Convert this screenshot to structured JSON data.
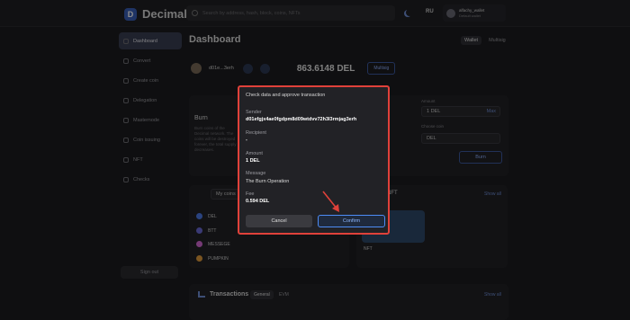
{
  "app": {
    "name": "Decimal"
  },
  "search": {
    "placeholder": "Search by address, hash, block, coins, NFTs"
  },
  "header": {
    "lang": "RU",
    "account_name": "alfachy_wallet",
    "account_sub": "Default wallet"
  },
  "sidebar": {
    "items": [
      {
        "label": "Dashboard"
      },
      {
        "label": "Convert"
      },
      {
        "label": "Create coin"
      },
      {
        "label": "Delegation"
      },
      {
        "label": "Masternode"
      },
      {
        "label": "Coin issuing"
      },
      {
        "label": "NFT"
      },
      {
        "label": "Checks"
      }
    ],
    "signout": "Sign out"
  },
  "main": {
    "title": "Dashboard",
    "wallet_tabs": [
      "Wallet",
      "Multisig"
    ],
    "wallet_address_short": "d01e...3erh",
    "balance": "863.6148 DEL",
    "wallet_button": "Multisig",
    "burn": {
      "title": "Burn",
      "desc": "Burn coins of the Decimal network. The coins will be destroyed forever, the total supply decreases.",
      "amount_label": "Amount",
      "amount_value": "1 DEL",
      "max_label": "Max",
      "coin_label": "Choose coin",
      "coin_value": "DEL",
      "button": "Burn"
    },
    "coins_filter": "My coins",
    "show_all": "Show all",
    "nft_label": "NFT",
    "nft_item": "NFT",
    "coins": [
      {
        "name": "DEL",
        "color": "#4d7be8"
      },
      {
        "name": "BTT",
        "color": "#6b6bd6"
      },
      {
        "name": "MESSEGE",
        "color": "#d66bd6"
      },
      {
        "name": "PUMPKIN",
        "color": "#e09b3d"
      }
    ],
    "transactions": {
      "title": "Transactions",
      "tabs": [
        "General",
        "EVM"
      ]
    }
  },
  "modal": {
    "title": "Check data and approve transaction",
    "sender_label": "Sender",
    "sender_value": "d01efgjx4ae0fgdpm8d09wtdvv72h3l3rmjag3erh",
    "recipient_label": "Recipient",
    "recipient_value": "-",
    "amount_label": "Amount",
    "amount_value": "1 DEL",
    "message_label": "Message",
    "message_value": "The Burn Operation",
    "fee_label": "Fee",
    "fee_value": "0.594 DEL",
    "cancel": "Cancel",
    "confirm": "Confirm"
  },
  "colors": {
    "accent": "#4d8cf5",
    "highlight": "#e0413a"
  }
}
